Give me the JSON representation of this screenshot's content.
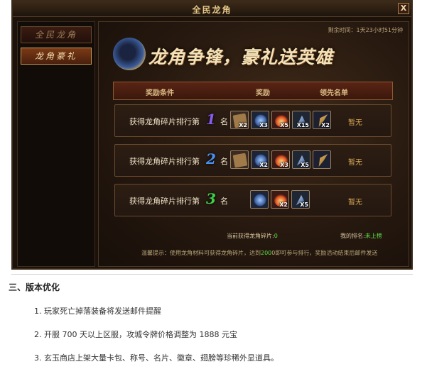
{
  "window": {
    "title": "全民龙角",
    "close_label": "X"
  },
  "sidebar": {
    "items": [
      {
        "label": "全民龙角"
      },
      {
        "label": "龙角豪礼"
      }
    ]
  },
  "main": {
    "timer": "剩余时间：1天23小时51分钟",
    "banner": "龙角争锋，豪礼送英雄",
    "headers": {
      "condition": "奖励条件",
      "reward": "奖励",
      "leader": "领先名单"
    },
    "rows": [
      {
        "label": "获得龙角碎片排行第",
        "rank": "1",
        "rank_color": "#8a5cf0",
        "ming": "名",
        "rewards": [
          {
            "icon": "book-icon",
            "qty": "X2"
          },
          {
            "icon": "gem-icon",
            "qty": "X3"
          },
          {
            "icon": "fire-orb-icon",
            "qty": "X5"
          },
          {
            "icon": "bird-icon",
            "qty": "X15"
          },
          {
            "icon": "feather-icon",
            "qty": "X2"
          }
        ],
        "status": "暂无"
      },
      {
        "label": "获得龙角碎片排行第",
        "rank": "2",
        "rank_color": "#4a90f0",
        "ming": "名",
        "rewards": [
          {
            "icon": "book-icon",
            "qty": ""
          },
          {
            "icon": "gem-icon",
            "qty": "X2"
          },
          {
            "icon": "fire-orb-icon",
            "qty": "X3"
          },
          {
            "icon": "bird-icon",
            "qty": "X5"
          },
          {
            "icon": "feather-icon",
            "qty": ""
          }
        ],
        "status": "暂无"
      },
      {
        "label": "获得龙角碎片排行第",
        "rank": "3",
        "rank_color": "#3fcf4a",
        "ming": "名",
        "rewards": [
          {
            "icon": "gem-icon",
            "qty": ""
          },
          {
            "icon": "fire-orb-icon",
            "qty": "X2"
          },
          {
            "icon": "bird-icon",
            "qty": "X5"
          }
        ],
        "status": "暂无"
      }
    ],
    "current_label": "当前获得龙角碎片:",
    "current_value": "0",
    "my_rank_label": "我的排名:",
    "my_rank_value": "未上榜",
    "tip_prefix": "温馨提示：使用龙角材料可获得龙角碎片，达到",
    "tip_highlight": "200",
    "tip_suffix": "0即可参与排行，奖励活动结束后邮件发送"
  },
  "doc": {
    "section": "三、版本优化",
    "items": [
      "1.  玩家死亡掉落装备将发送邮件提醒",
      "2.  开服 700 天以上区服，攻城令牌价格调整为 1888 元宝",
      "3.  玄玉商店上架大量卡包、称号、名片、徽章、翅膀等珍稀外显道具。"
    ]
  }
}
